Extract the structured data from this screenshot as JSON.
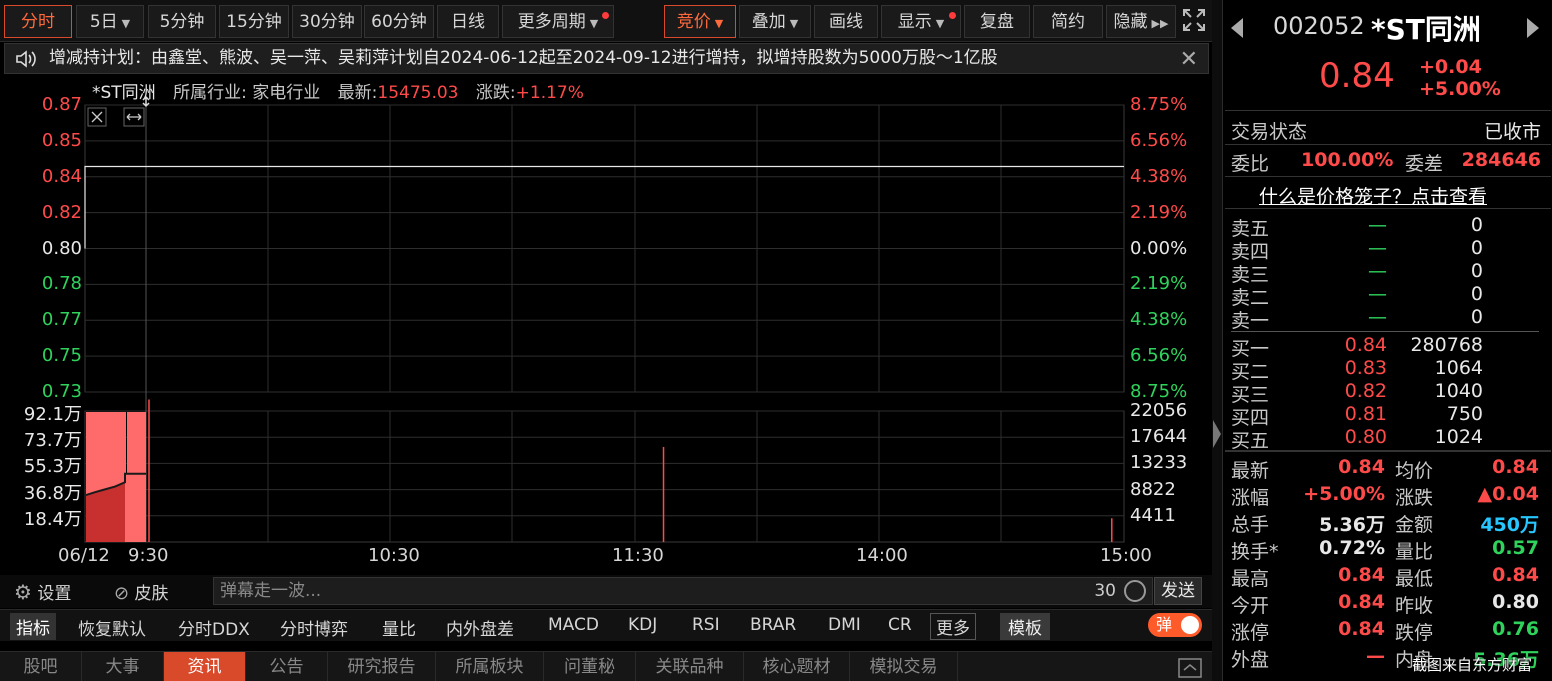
{
  "toolbar": {
    "periods": [
      "分时",
      "5日",
      "5分钟",
      "15分钟",
      "30分钟",
      "60分钟",
      "日线",
      "更多周期"
    ],
    "tools": [
      "竞价",
      "叠加",
      "画线",
      "显示",
      "复盘",
      "简约",
      "隐藏"
    ]
  },
  "notice": {
    "text": "增减持计划：由鑫堂、熊波、吴一萍、吴莉萍计划自2024-06-12起至2024-09-12进行增持，拟增持股数为5000万股～1亿股"
  },
  "chart_info": {
    "name": "*ST同洲",
    "industry": "所属行业:  家电行业",
    "latest_label": "最新:",
    "latest_value": "15475.03",
    "change_label": "涨跌:",
    "change_value": "+1.17%"
  },
  "chart_data": {
    "type": "line",
    "price_axis": [
      "0.87",
      "0.85",
      "0.84",
      "0.82",
      "0.80",
      "0.78",
      "0.77",
      "0.75",
      "0.73"
    ],
    "pct_axis": [
      "8.75%",
      "6.56%",
      "4.38%",
      "2.19%",
      "0.00%",
      "2.19%",
      "4.38%",
      "6.56%",
      "8.75%"
    ],
    "volume_axis_left": [
      "92.1万",
      "73.7万",
      "55.3万",
      "36.8万",
      "18.4万"
    ],
    "volume_axis_right": [
      "22056",
      "17644",
      "13233",
      "8822",
      "4411"
    ],
    "time_axis": [
      "06/12",
      "9:30",
      "10:30",
      "11:30",
      "14:00",
      "15:00"
    ],
    "prev_close": 0.8,
    "ylim": [
      0.73,
      0.87
    ],
    "price_series": [
      {
        "t": "9:30",
        "price": 0.84
      },
      {
        "t": "15:00",
        "price": 0.84
      }
    ],
    "volume_series": [
      {
        "t": "9:30",
        "volume_wan": 2.4
      },
      {
        "t": "13:07",
        "volume_wan": 1.6
      },
      {
        "t": "14:57",
        "volume_wan": 0.4
      }
    ],
    "auction_volume_max_wan": 92.1
  },
  "controls": {
    "settings": "设置",
    "skin": "皮肤",
    "danmu_placeholder": "弹幕走一波...",
    "danmu_count": "30",
    "send": "发送"
  },
  "indicators": [
    "指标",
    "恢复默认",
    "分时DDX",
    "分时博弈",
    "量比",
    "内外盘差",
    "MACD",
    "KDJ",
    "RSI",
    "BRAR",
    "DMI",
    "CR",
    "更多",
    "模板"
  ],
  "danmu_toggle": "弹",
  "bottom_tabs": [
    "股吧",
    "大事",
    "资讯",
    "公告",
    "研究报告",
    "所属板块",
    "问董秘",
    "关联品种",
    "核心题材",
    "模拟交易"
  ],
  "panel": {
    "code": "002052",
    "name": "*ST同洲",
    "price": "0.84",
    "change": "+0.04",
    "change_pct": "+5.00%",
    "trade_status_label": "交易状态",
    "trade_status": "已收市",
    "weibi_label": "委比",
    "weibi": "100.00%",
    "weicha_label": "委差",
    "weicha": "284646",
    "cage_link": "什么是价格笼子？点击查看",
    "asks": [
      {
        "label": "卖五",
        "price": "—",
        "vol": "0"
      },
      {
        "label": "卖四",
        "price": "—",
        "vol": "0"
      },
      {
        "label": "卖三",
        "price": "—",
        "vol": "0"
      },
      {
        "label": "卖二",
        "price": "—",
        "vol": "0"
      },
      {
        "label": "卖一",
        "price": "—",
        "vol": "0"
      }
    ],
    "bids": [
      {
        "label": "买一",
        "price": "0.84",
        "vol": "280768"
      },
      {
        "label": "买二",
        "price": "0.83",
        "vol": "1064"
      },
      {
        "label": "买三",
        "price": "0.82",
        "vol": "1040"
      },
      {
        "label": "买四",
        "price": "0.81",
        "vol": "750"
      },
      {
        "label": "买五",
        "price": "0.80",
        "vol": "1024"
      }
    ],
    "stats": [
      {
        "l1": "最新",
        "v1": "0.84",
        "c1": "up",
        "l2": "均价",
        "v2": "0.84",
        "c2": "up"
      },
      {
        "l1": "涨幅",
        "v1": "+5.00%",
        "c1": "up",
        "l2": "涨跌",
        "v2": "▲0.04",
        "c2": "up"
      },
      {
        "l1": "总手",
        "v1": "5.36万",
        "c1": "white",
        "l2": "金额",
        "v2": "450万",
        "c2": "cyan"
      },
      {
        "l1": "换手*",
        "v1": "0.72%",
        "c1": "white",
        "l2": "量比",
        "v2": "0.57",
        "c2": "down"
      },
      {
        "l1": "最高",
        "v1": "0.84",
        "c1": "up",
        "l2": "最低",
        "v2": "0.84",
        "c2": "up"
      },
      {
        "l1": "今开",
        "v1": "0.84",
        "c1": "up",
        "l2": "昨收",
        "v2": "0.80",
        "c2": "white"
      },
      {
        "l1": "涨停",
        "v1": "0.84",
        "c1": "up",
        "l2": "跌停",
        "v2": "0.76",
        "c2": "down"
      },
      {
        "l1": "外盘",
        "v1": "—",
        "c1": "up",
        "l2": "内盘",
        "v2": "5.36万",
        "c2": "down"
      }
    ]
  },
  "watermark": "截图来自东方财富",
  "colors": {
    "up": "#ff4a4a",
    "down": "#2fd35c",
    "accent": "#d94a2b",
    "cyan": "#27c6ff"
  }
}
